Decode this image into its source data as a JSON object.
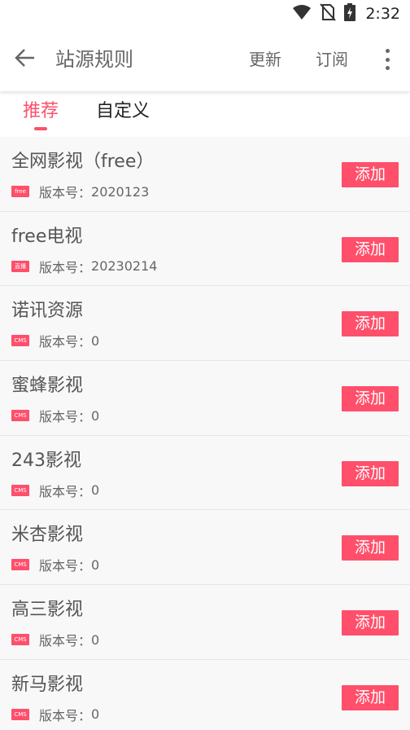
{
  "status_bar": {
    "time": "2:32",
    "icons": [
      "wifi-icon",
      "no-sim-icon",
      "battery-charging-icon"
    ]
  },
  "app_bar": {
    "back_icon": "arrow-left-icon",
    "title": "站源规则",
    "actions": {
      "update": "更新",
      "subscribe": "订阅"
    },
    "more_icon": "more-vert-icon"
  },
  "tabs": [
    {
      "label": "推荐",
      "active": true
    },
    {
      "label": "自定义",
      "active": false
    }
  ],
  "version_label": "版本号：",
  "add_label": "添加",
  "accent_color": "#ff4f6b",
  "sources": [
    {
      "name": "全网影视（free）",
      "badge": "free",
      "version": "2020123"
    },
    {
      "name": "free电视",
      "badge": "直播",
      "version": "20230214"
    },
    {
      "name": "诺讯资源",
      "badge": "CMS",
      "version": "0"
    },
    {
      "name": "蜜蜂影视",
      "badge": "CMS",
      "version": "0"
    },
    {
      "name": "243影视",
      "badge": "CMS",
      "version": "0"
    },
    {
      "name": "米杏影视",
      "badge": "CMS",
      "version": "0"
    },
    {
      "name": "高三影视",
      "badge": "CMS",
      "version": "0"
    },
    {
      "name": "新马影视",
      "badge": "CMS",
      "version": "0"
    }
  ]
}
